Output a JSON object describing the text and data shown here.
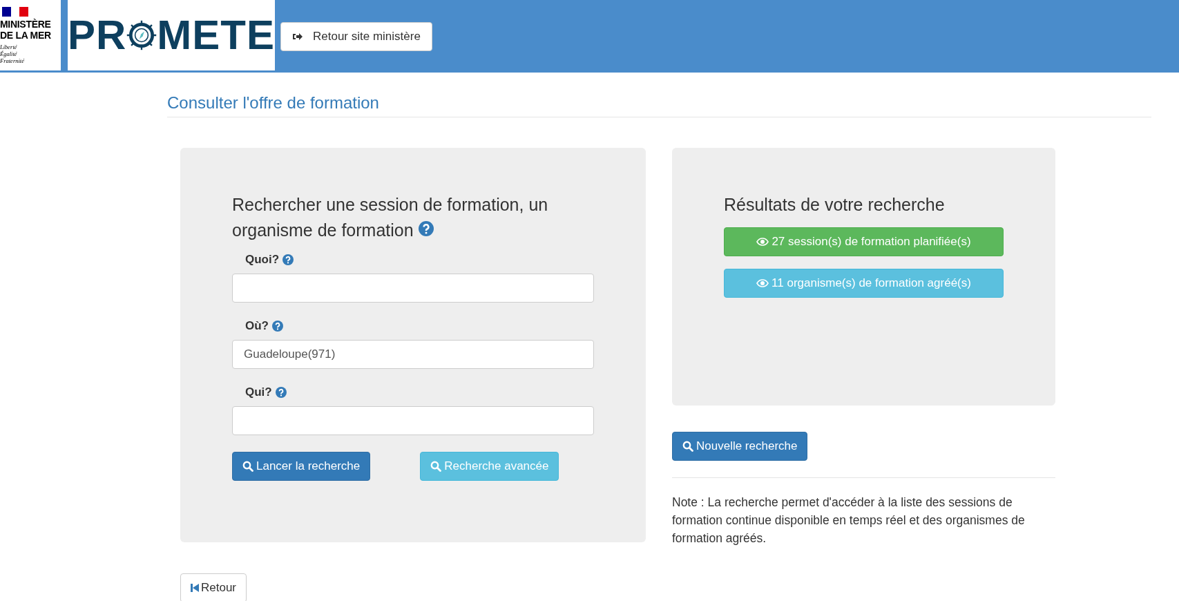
{
  "header": {
    "ministry": {
      "name_lines": [
        "MINISTÈRE",
        "DE LA MER"
      ],
      "motto": [
        "Liberté",
        "Égalité",
        "Fraternité"
      ]
    },
    "logo": {
      "before": "PR",
      "after": "METE"
    },
    "back_button": "Retour site ministère"
  },
  "page_title": "Consulter l'offre de formation",
  "search_panel": {
    "heading": "Rechercher une session de formation, un organisme de formation",
    "fields": [
      {
        "label": "Quoi?"
      },
      {
        "label": "Où?",
        "value": "Guadeloupe(971)"
      },
      {
        "label": "Qui?"
      }
    ],
    "buttons": [
      {
        "label": "Lancer la recherche",
        "kind": "primary"
      },
      {
        "label": "Recherche avancée",
        "kind": "info"
      }
    ]
  },
  "results_panel": {
    "heading": "Résultats de votre recherche",
    "results": [
      {
        "label": "27 session(s) de formation planifiée(s)",
        "kind": "success"
      },
      {
        "label": "11 organisme(s) de formation agréé(s)",
        "kind": "info"
      }
    ]
  },
  "new_search_button": "Nouvelle recherche",
  "note": "Note : La recherche permet d'accéder à la liste des sessions de formation continue disponible en temps réel et des organismes de formation agréés.",
  "back_button": "Retour"
}
